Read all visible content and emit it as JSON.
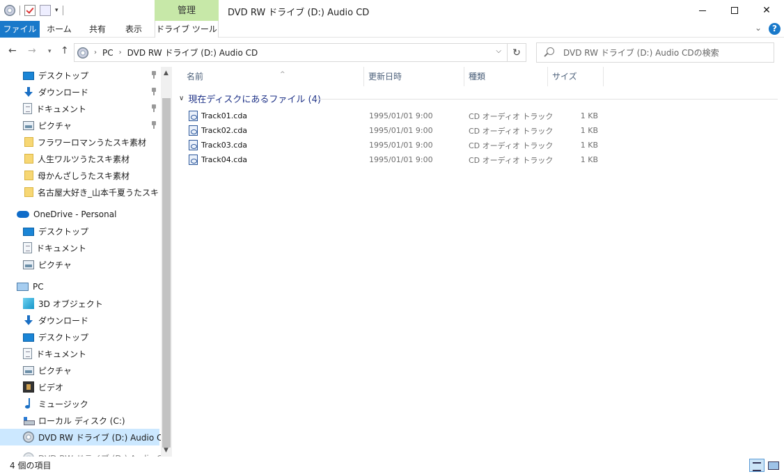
{
  "window": {
    "title": "DVD RW ドライブ (D:) Audio CD",
    "manage_tab": "管理",
    "qat_arrow": "▾"
  },
  "ribbon": {
    "tabs": [
      "ファイル",
      "ホーム",
      "共有",
      "表示",
      "ドライブ ツール"
    ],
    "help": "?"
  },
  "address": {
    "crumbs": [
      "PC",
      "DVD RW ドライブ (D:) Audio CD"
    ],
    "search_placeholder": "DVD RW ドライブ (D:) Audio CDの検索"
  },
  "nav_pane": {
    "quick_access": [
      {
        "label": "デスクトップ",
        "icon": "desktop-icon"
      },
      {
        "label": "ダウンロード",
        "icon": "download-icon"
      },
      {
        "label": "ドキュメント",
        "icon": "document-icon"
      },
      {
        "label": "ピクチャ",
        "icon": "pictures-icon"
      },
      {
        "label": "フラワーロマンうたスキ素材",
        "icon": "folder-icon"
      },
      {
        "label": "人生ワルツうたスキ素材",
        "icon": "folder-icon"
      },
      {
        "label": "母かんざしうたスキ素材",
        "icon": "folder-icon"
      },
      {
        "label": "名古屋大好き_山本千夏うたスキ",
        "icon": "folder-icon"
      }
    ],
    "onedrive": {
      "label": "OneDrive - Personal",
      "items": [
        "デスクトップ",
        "ドキュメント",
        "ピクチャ"
      ]
    },
    "pc": {
      "label": "PC",
      "items": [
        {
          "label": "3D オブジェクト",
          "icon": "3d-objects-icon"
        },
        {
          "label": "ダウンロード",
          "icon": "download-icon"
        },
        {
          "label": "デスクトップ",
          "icon": "desktop-icon"
        },
        {
          "label": "ドキュメント",
          "icon": "document-icon"
        },
        {
          "label": "ピクチャ",
          "icon": "pictures-icon"
        },
        {
          "label": "ビデオ",
          "icon": "video-icon"
        },
        {
          "label": "ミュージック",
          "icon": "music-icon"
        },
        {
          "label": "ローカル ディスク (C:)",
          "icon": "local-disk-icon"
        },
        {
          "label": "DVD RW ドライブ (D:) Audio CD",
          "icon": "cd-drive-icon"
        }
      ]
    }
  },
  "file_list": {
    "columns": [
      "名前",
      "更新日時",
      "種類",
      "サイズ"
    ],
    "group_label": "現在ディスクにあるファイル (4)",
    "files": [
      {
        "name": "Track01.cda",
        "date": "1995/01/01 9:00",
        "type": "CD オーディオ トラック",
        "size": "1 KB"
      },
      {
        "name": "Track02.cda",
        "date": "1995/01/01 9:00",
        "type": "CD オーディオ トラック",
        "size": "1 KB"
      },
      {
        "name": "Track03.cda",
        "date": "1995/01/01 9:00",
        "type": "CD オーディオ トラック",
        "size": "1 KB"
      },
      {
        "name": "Track04.cda",
        "date": "1995/01/01 9:00",
        "type": "CD オーディオ トラック",
        "size": "1 KB"
      }
    ]
  },
  "status": {
    "item_count": "4 個の項目"
  },
  "colors": {
    "file_tab": "#1979ca",
    "manage_tab": "#c7e8a8",
    "selected_nav": "#cce8ff",
    "group_header": "#1e3287"
  }
}
